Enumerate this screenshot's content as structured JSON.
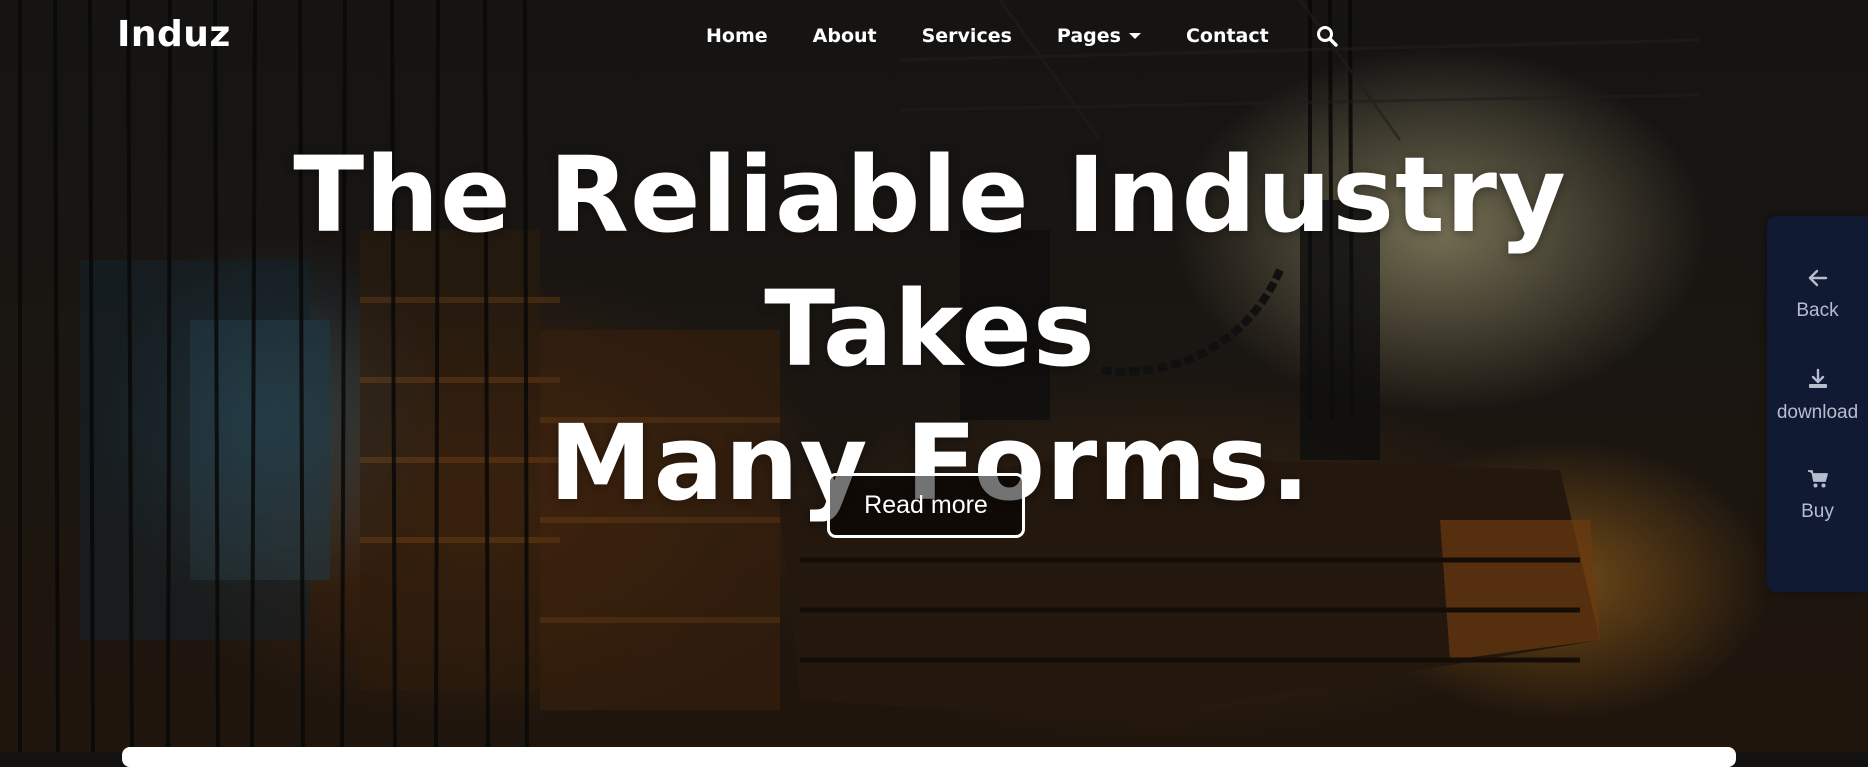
{
  "brand": {
    "name": "Induz"
  },
  "nav": {
    "items": [
      {
        "label": "Home"
      },
      {
        "label": "About"
      },
      {
        "label": "Services"
      },
      {
        "label": "Pages",
        "has_dropdown": true
      },
      {
        "label": "Contact"
      }
    ],
    "search_icon": "search-icon"
  },
  "hero": {
    "headline_line1": "The Reliable Industry Takes",
    "headline_line2": "Many Forms.",
    "cta_label": "Read more"
  },
  "side_panel": {
    "back_label": "Back",
    "back_icon": "arrow-left-icon",
    "download_label": "download",
    "download_icon": "download-icon",
    "buy_label": "Buy",
    "buy_icon": "cart-icon"
  },
  "colors": {
    "panel_bg": "#111a33",
    "panel_text": "#b6bdcd",
    "text": "#ffffff"
  }
}
